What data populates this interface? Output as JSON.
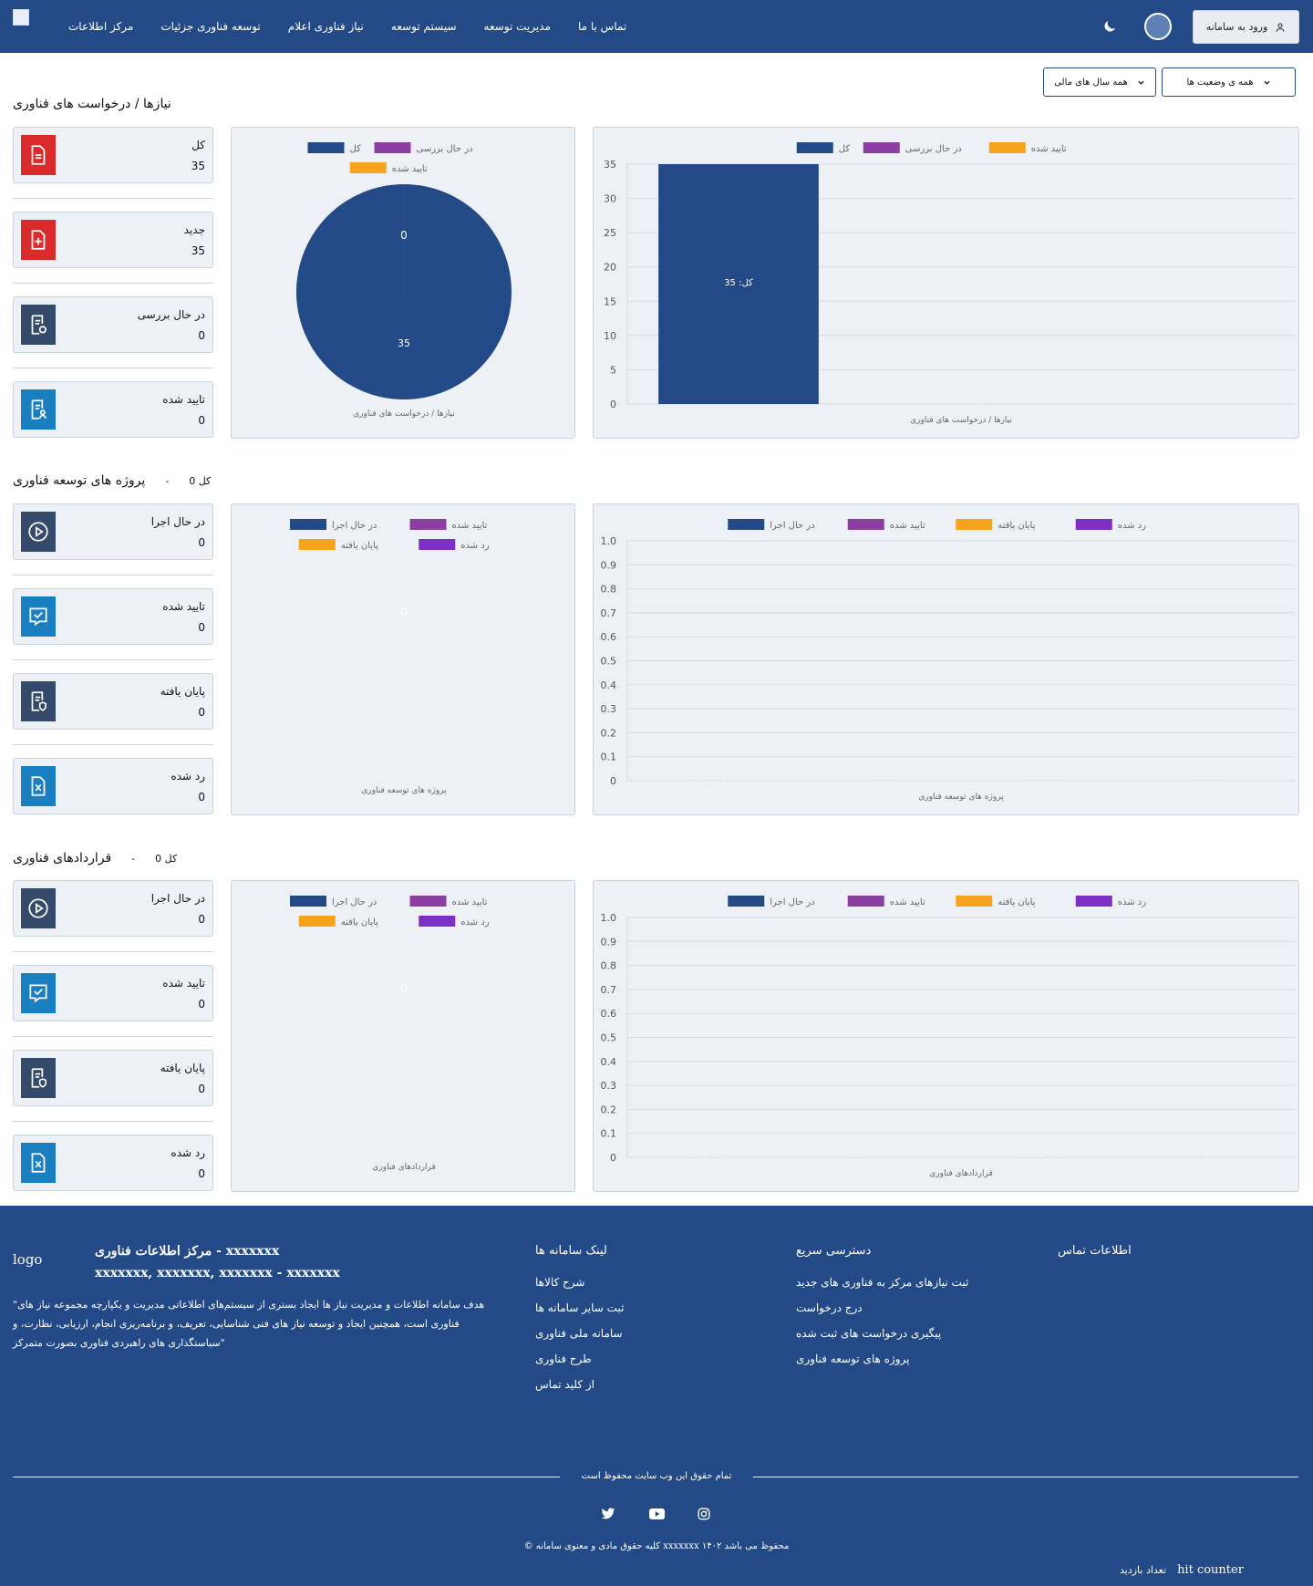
{
  "header": {
    "nav": [
      "ﻣﺮﮐﺰ اﻃﻼﻋﺎت",
      "ﺗﻮﺳﻌﻪ ﻓﻨﺎوری ﺟﺰﺋﯿﺎت",
      "ﻧﯿﺎز ﻓﻨﺎوری اﻋﻼم",
      "ﺳﯿﺴﺘﻢ ﺗﻮﺳﻌﻪ",
      "ﻣﺪﯾﺮﯾﺖ ﺗﻮﺳﻌﻪ",
      "ﺗﻤﺎس ﺑﺎ ﻣﺎ"
    ],
    "login_label": "ورود به سامانه"
  },
  "filters": {
    "dd1": "همه سال های مالی",
    "dd2": "همه ی وضعیت ها"
  },
  "sections": [
    {
      "title": "نیازها / درخواست های فناوری",
      "sub": "",
      "cards": [
        {
          "label": "کل",
          "value": "35",
          "icon": "file-red-icon"
        },
        {
          "label": "جدید",
          "value": "35",
          "icon": "file-plus-red-icon"
        },
        {
          "label": "در حال بررسی",
          "value": "0",
          "icon": "file-refresh-icon"
        },
        {
          "label": "تایید شده",
          "value": "0",
          "icon": "file-user-icon"
        }
      ],
      "pie": {
        "legend": [
          "کل",
          "در حال بررسی",
          "تایید شده"
        ],
        "labels": [
          "0",
          "35"
        ],
        "xlabel": "نیازها / درخواست های فناوری"
      },
      "bar": {
        "legend": [
          "کل",
          "در حال بررسی",
          "تایید شده"
        ],
        "xlabel": "نیازها / درخواست های فناوری",
        "data_label": "کل: 35"
      }
    },
    {
      "title": "پروژه های توسعه فناوری",
      "sub": "کل 0",
      "cards": [
        {
          "label": "در حال اجرا",
          "value": "0",
          "icon": "play-circle-icon"
        },
        {
          "label": "تایید شده",
          "value": "0",
          "icon": "check-message-icon"
        },
        {
          "label": "پایان یافته",
          "value": "0",
          "icon": "file-shield-icon"
        },
        {
          "label": "رد شده",
          "value": "0",
          "icon": "file-x-icon"
        }
      ],
      "pie": {
        "legend": [
          "در حال اجرا",
          "تایید شده",
          "پایان یافته",
          "رد شده"
        ],
        "labels": [
          "0"
        ],
        "xlabel": "پروژه های توسعه فناوری"
      },
      "bar": {
        "legend": [
          "در حال اجرا",
          "تایید شده",
          "پایان یافته",
          "رد شده"
        ],
        "xlabel": "پروژه های توسعه فناوری"
      }
    },
    {
      "title": "قراردادهای فناوری",
      "sub": "کل 0",
      "cards": [
        {
          "label": "در حال اجرا",
          "value": "0",
          "icon": "play-circle-icon"
        },
        {
          "label": "تایید شده",
          "value": "0",
          "icon": "check-message-icon"
        },
        {
          "label": "پایان یافته",
          "value": "0",
          "icon": "file-shield-icon"
        },
        {
          "label": "رد شده",
          "value": "0",
          "icon": "file-x-icon"
        }
      ],
      "pie": {
        "legend": [
          "در حال اجرا",
          "تایید شده",
          "پایان یافته",
          "رد شده"
        ],
        "labels": [
          "0"
        ],
        "xlabel": "قراردادهای فناوری"
      },
      "bar": {
        "legend": [
          "در حال اجرا",
          "تایید شده",
          "پایان یافته",
          "رد شده"
        ],
        "xlabel": "قراردادهای فناوری"
      }
    }
  ],
  "chart_data": [
    {
      "type": "pie",
      "series": [
        {
          "name": "کل",
          "values": [
            35
          ]
        }
      ],
      "labels_shown": [
        "0",
        "35"
      ]
    },
    {
      "type": "bar",
      "categories": [
        "کل",
        "در حال بررسی",
        "تایید شده"
      ],
      "values": [
        35,
        0,
        0
      ],
      "ylim": [
        0,
        35
      ],
      "yticks": [
        0,
        5,
        10,
        15,
        20,
        25,
        30,
        35
      ]
    },
    {
      "type": "pie",
      "values": [
        0,
        0,
        0,
        0
      ]
    },
    {
      "type": "bar",
      "categories": [
        "در حال اجرا",
        "تایید شده",
        "پایان یافته",
        "رد شده"
      ],
      "values": [
        0,
        0,
        0,
        0
      ],
      "ylim": [
        0,
        1
      ],
      "yticks": [
        "0",
        "0.1",
        "0.2",
        "0.3",
        "0.4",
        "0.5",
        "0.6",
        "0.7",
        "0.8",
        "0.9",
        "1.0"
      ]
    },
    {
      "type": "pie",
      "values": [
        0,
        0,
        0,
        0
      ]
    },
    {
      "type": "bar",
      "categories": [
        "در حال اجرا",
        "تایید شده",
        "پایان یافته",
        "رد شده"
      ],
      "values": [
        0,
        0,
        0,
        0
      ],
      "ylim": [
        0,
        1
      ],
      "yticks": [
        "0",
        "0.1",
        "0.2",
        "0.3",
        "0.4",
        "0.5",
        "0.6",
        "0.7",
        "0.8",
        "0.9",
        "1.0"
      ]
    }
  ],
  "colors": {
    "primary": "#234a86",
    "purple": "#8a3fa0",
    "orange": "#f5a21d",
    "violet": "#7b2fc4",
    "red_icon": "#d92b2b",
    "blue_icon": "#1a7fc0",
    "slate_icon": "#334a6a"
  },
  "footer": {
    "logo_alt": "logo",
    "org": "مرکز اطلاعات فناوری - xxxxxxx",
    "address": "xxxxxxx, xxxxxxx, xxxxxxx - xxxxxxx",
    "quote": "\"هدف سامانه اطلاعات و مدیریت نیاز ها ایجاد بستری از سیستم‌های اطلاعاتی مدیریت و یکپارچه مجموعه نیاز های فناوری است، همچنین ایجاد و توسعه نیاز های فنی شناسایی، تعریف، و برنامه‌ریزی انجام، ارزیابی، نظارت، و سیاستگذاری های راهبردی فناوری بصورت متمرکز\"",
    "col1_title": "لینک سامانه ها",
    "col1": [
      "شرح کالاها",
      "ثبت سایر سامانه ها",
      "سامانه ملی فناوری",
      "طرح فناوری",
      "از کلید تماس"
    ],
    "col2_title": "دسترسی سریع",
    "col2": [
      "ثبت نیازهای مرکز به فناوری های جدید",
      "درج درخواست",
      "پیگیری درخواست های ثبت شده",
      "پروژه های توسعه فناوری"
    ],
    "col3_title": "اطلاعات تماس",
    "center_text": "تمام حقوق این وب سایت محفوظ است",
    "copyright": "© کلیه حقوق مادی و معنوی سامانه xxxxxxx ۱۴۰۲ محفوظ می باشد",
    "visits_label": "تعداد بازدید",
    "counter_alt": "hit counter"
  }
}
